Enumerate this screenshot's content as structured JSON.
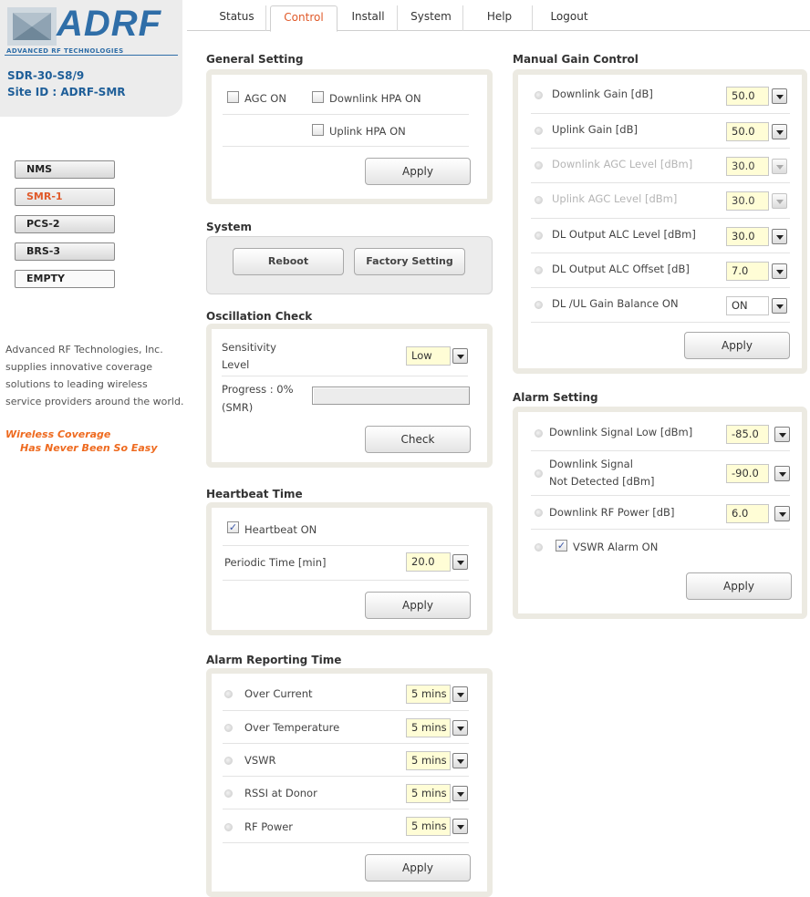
{
  "brand": {
    "logo_text": "ADRF",
    "tagline": "ADVANCED RF TECHNOLOGIES",
    "model": "SDR-30-S8/9",
    "site_id": "Site ID : ADRF-SMR"
  },
  "colors": {
    "brand_blue": "#2f6ea8",
    "accent_orange": "#e05a2a",
    "panel_border": "#eceae2",
    "select_bg": "#fffdd6"
  },
  "sidebar": {
    "items": [
      {
        "label": "NMS"
      },
      {
        "label": "SMR-1"
      },
      {
        "label": "PCS-2"
      },
      {
        "label": "BRS-3"
      },
      {
        "label": "EMPTY"
      }
    ],
    "about": "Advanced RF Technologies, Inc. supplies innovative coverage solutions to leading wireless service providers around the world.",
    "slogan_line1": "Wireless Coverage",
    "slogan_line2": "Has Never Been So Easy"
  },
  "nav": {
    "tabs": [
      {
        "label": "Status"
      },
      {
        "label": "Control"
      },
      {
        "label": "Install"
      },
      {
        "label": "System"
      },
      {
        "label": "Help"
      },
      {
        "label": "Logout"
      }
    ],
    "active": "Control"
  },
  "general": {
    "title": "General Setting",
    "agc_label": "AGC ON",
    "dl_hpa_label": "Downlink HPA ON",
    "ul_hpa_label": "Uplink HPA ON",
    "apply": "Apply"
  },
  "system": {
    "title": "System",
    "reboot": "Reboot",
    "factory": "Factory Setting"
  },
  "oscillation": {
    "title": "Oscillation Check",
    "sensitivity_line1": "Sensitivity",
    "sensitivity_line2": "Level",
    "sensitivity_value": "Low",
    "progress_line1": "Progress : 0%",
    "progress_line2": "(SMR)",
    "progress_fraction": 0,
    "check": "Check"
  },
  "heartbeat": {
    "title": "Heartbeat Time",
    "hb_label": "Heartbeat ON",
    "periodic_label": "Periodic Time [min]",
    "periodic_value": "20.0",
    "apply": "Apply"
  },
  "alarm_reporting": {
    "title": "Alarm Reporting Time",
    "rows": [
      {
        "label": "Over Current",
        "value": "5 mins"
      },
      {
        "label": "Over Temperature",
        "value": "5 mins"
      },
      {
        "label": "VSWR",
        "value": "5 mins"
      },
      {
        "label": "RSSI at Donor",
        "value": "5 mins"
      },
      {
        "label": "RF Power",
        "value": "5 mins"
      }
    ],
    "apply": "Apply"
  },
  "manual_gain": {
    "title": "Manual Gain Control",
    "rows": [
      {
        "label": "Downlink Gain [dB]",
        "value": "50.0"
      },
      {
        "label": "Uplink Gain [dB]",
        "value": "50.0"
      },
      {
        "label": "Downlink AGC Level [dBm]",
        "value": "30.0"
      },
      {
        "label": "Uplink AGC Level [dBm]",
        "value": "30.0"
      },
      {
        "label": "DL Output ALC Level [dBm]",
        "value": "30.0"
      },
      {
        "label": "DL Output ALC Offset [dB]",
        "value": "7.0"
      },
      {
        "label": "DL /UL Gain Balance ON",
        "value": "ON"
      }
    ],
    "apply": "Apply"
  },
  "alarm_setting": {
    "title": "Alarm Setting",
    "dl_signal_low_label": "Downlink Signal Low [dBm]",
    "dl_signal_low_value": "-85.0",
    "dl_not_detected_line1": "Downlink Signal",
    "dl_not_detected_line2": "Not Detected [dBm]",
    "dl_not_detected_value": "-90.0",
    "dl_rf_power_label": "Downlink RF Power [dB]",
    "dl_rf_power_value": "6.0",
    "vswr_label": "VSWR Alarm ON",
    "apply": "Apply"
  }
}
